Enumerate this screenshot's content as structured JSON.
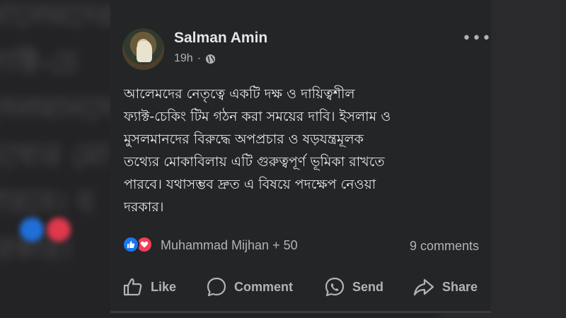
{
  "post": {
    "author": "Salman Amin",
    "time": "19h",
    "separator": "·",
    "more": "•••",
    "text_lines": [
      "আলেমদের নেতৃত্বে একটি দক্ষ ও দায়িত্বশীল",
      "ফ্যাক্ট-চেকিং টিম গঠন করা সময়ের দাবি। ইসলাম ও",
      "মুসলমানদের বিরুদ্ধে অপপ্রচার ও ষড়যন্ত্রমূলক",
      "তথ্যের মোকাবিলায় এটি গুরুত্বপূর্ণ ভূমিকা রাখতে",
      "পারবে। যথাসম্ভব দ্রুত এ বিষয়ে পদক্ষেপ নেওয়া",
      "দরকার।"
    ],
    "reactions_text": "Muhammad Mijhan + 50",
    "comments_text": "9 comments"
  },
  "actions": {
    "like": "Like",
    "comment": "Comment",
    "send": "Send",
    "share": "Share"
  },
  "colors": {
    "card_bg": "#242526",
    "text_primary": "#e4e6eb",
    "text_secondary": "#b0b3b8",
    "like_blue": "#1877f2",
    "love_red": "#f33e58"
  },
  "icons": [
    "globe-icon",
    "more-icon",
    "like-reaction-icon",
    "love-reaction-icon",
    "like-icon",
    "comment-icon",
    "send-icon",
    "share-icon"
  ]
}
